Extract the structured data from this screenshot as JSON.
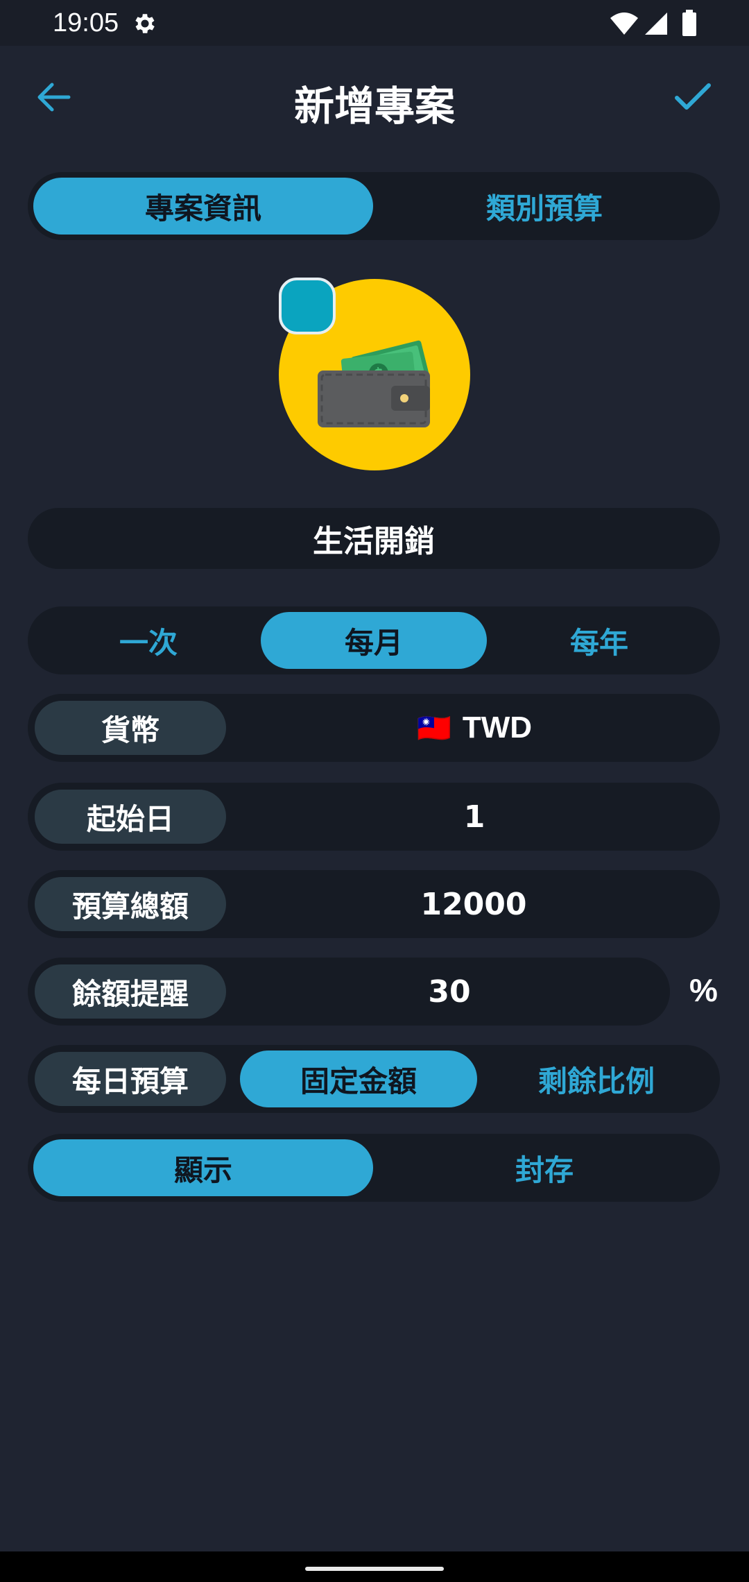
{
  "status_bar": {
    "time": "19:05",
    "icons": [
      "gear-icon",
      "wifi-icon",
      "signal-icon",
      "battery-icon"
    ]
  },
  "header": {
    "title": "新增專案",
    "back_icon": "arrow-left-icon",
    "confirm_icon": "check-icon"
  },
  "tabs": {
    "items": [
      "專案資訊",
      "類別預算"
    ],
    "selected": "專案資訊"
  },
  "project": {
    "icon": "wallet-icon",
    "icon_background_color": "#fecb00",
    "theme_color": "#0aa4bf",
    "name": "生活開銷"
  },
  "frequency": {
    "options": [
      "一次",
      "每月",
      "每年"
    ],
    "selected": "每月"
  },
  "fields": {
    "currency": {
      "label": "貨幣",
      "flag": "🇹🇼",
      "value": "TWD"
    },
    "start_day": {
      "label": "起始日",
      "value": "1"
    },
    "budget_total": {
      "label": "預算總額",
      "value": "12000"
    },
    "balance_alert": {
      "label": "餘額提醒",
      "value": "30",
      "unit": "%"
    },
    "daily_budget": {
      "label": "每日預算",
      "options": [
        "固定金額",
        "剩餘比例"
      ],
      "selected": "固定金額"
    }
  },
  "visibility": {
    "options": [
      "顯示",
      "封存"
    ],
    "selected": "顯示"
  },
  "colors": {
    "accent": "#2fa8d5",
    "background": "#1f2431",
    "field_background": "#161b24",
    "label_chip": "#2b3a45"
  }
}
